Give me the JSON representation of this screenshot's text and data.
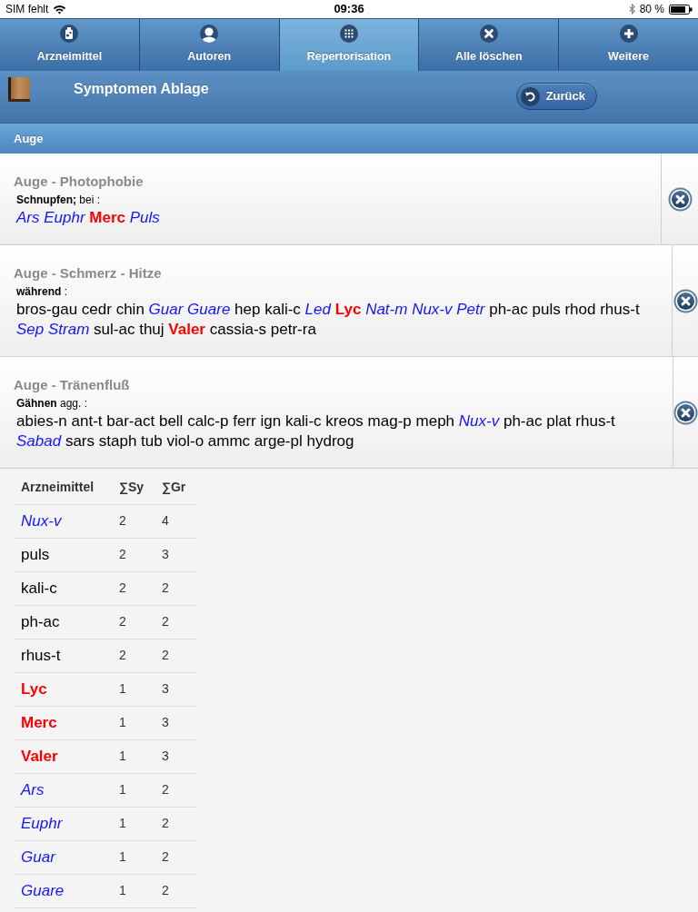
{
  "status_bar": {
    "carrier": "SIM fehlt",
    "time": "09:36",
    "battery": "80 %"
  },
  "tabs": [
    {
      "label": "Arzneimittel",
      "kind": "remedies",
      "selected": false
    },
    {
      "label": "Autoren",
      "kind": "authors",
      "selected": false
    },
    {
      "label": "Repertorisation",
      "kind": "repertory",
      "selected": true
    },
    {
      "label": "Alle löschen",
      "kind": "clear",
      "selected": false
    },
    {
      "label": "Weitere",
      "kind": "more",
      "selected": false
    }
  ],
  "header": {
    "title": "Symptomen Ablage",
    "back_button": "Zurück"
  },
  "section": {
    "title": "Auge"
  },
  "symptoms": [
    {
      "title": "Auge - Photophobie",
      "modifier": "**Schnupfen;** bei :",
      "remedies": [
        {
          "name": "Ars",
          "kind": "italic"
        },
        {
          "name": "Euphr",
          "kind": "italic"
        },
        {
          "name": "Merc",
          "kind": "bold"
        },
        {
          "name": "Puls",
          "kind": "italic"
        }
      ]
    },
    {
      "title": "Auge - Schmerz - Hitze",
      "modifier": "**während** :",
      "remedies": [
        {
          "name": "bros-gau",
          "kind": "plain"
        },
        {
          "name": "cedr",
          "kind": "plain"
        },
        {
          "name": "chin",
          "kind": "plain"
        },
        {
          "name": "Guar",
          "kind": "italic"
        },
        {
          "name": "Guare",
          "kind": "italic"
        },
        {
          "name": "hep",
          "kind": "plain"
        },
        {
          "name": "kali-c",
          "kind": "plain"
        },
        {
          "name": "Led",
          "kind": "italic"
        },
        {
          "name": "Lyc",
          "kind": "bold"
        },
        {
          "name": "Nat-m",
          "kind": "italic"
        },
        {
          "name": "Nux-v",
          "kind": "italic"
        },
        {
          "name": "Petr",
          "kind": "italic"
        },
        {
          "name": "ph-ac",
          "kind": "plain"
        },
        {
          "name": "puls",
          "kind": "plain"
        },
        {
          "name": "rhod",
          "kind": "plain"
        },
        {
          "name": "rhus-t",
          "kind": "plain"
        },
        {
          "name": "Sep",
          "kind": "italic"
        },
        {
          "name": "Stram",
          "kind": "italic"
        },
        {
          "name": "sul-ac",
          "kind": "plain"
        },
        {
          "name": "thuj",
          "kind": "plain"
        },
        {
          "name": "Valer",
          "kind": "bold"
        },
        {
          "name": "cassia-s",
          "kind": "plain"
        },
        {
          "name": "petr-ra",
          "kind": "plain"
        }
      ]
    },
    {
      "title": "Auge - Tränenfluß",
      "modifier": "**Gähnen** agg. :",
      "remedies": [
        {
          "name": "abies-n",
          "kind": "plain"
        },
        {
          "name": "ant-t",
          "kind": "plain"
        },
        {
          "name": "bar-act",
          "kind": "plain"
        },
        {
          "name": "bell",
          "kind": "plain"
        },
        {
          "name": "calc-p",
          "kind": "plain"
        },
        {
          "name": "ferr",
          "kind": "plain"
        },
        {
          "name": "ign",
          "kind": "plain"
        },
        {
          "name": "kali-c",
          "kind": "plain"
        },
        {
          "name": "kreos",
          "kind": "plain"
        },
        {
          "name": "mag-p",
          "kind": "plain"
        },
        {
          "name": "meph",
          "kind": "plain"
        },
        {
          "name": "Nux-v",
          "kind": "italic"
        },
        {
          "name": "ph-ac",
          "kind": "plain"
        },
        {
          "name": "plat",
          "kind": "plain"
        },
        {
          "name": "rhus-t",
          "kind": "plain"
        },
        {
          "name": "Sabad",
          "kind": "italic"
        },
        {
          "name": "sars",
          "kind": "plain"
        },
        {
          "name": "staph",
          "kind": "plain"
        },
        {
          "name": "tub",
          "kind": "plain"
        },
        {
          "name": "viol-o",
          "kind": "plain"
        },
        {
          "name": "ammc",
          "kind": "plain"
        },
        {
          "name": "arge-pl",
          "kind": "plain"
        },
        {
          "name": "hydrog",
          "kind": "plain"
        }
      ]
    }
  ],
  "table": {
    "columns": [
      "Arzneimittel",
      "∑Sy",
      "∑Gr"
    ],
    "rows": [
      {
        "remedy": "Nux-v",
        "kind": "italic",
        "sy": "2",
        "gr": "4"
      },
      {
        "remedy": "puls",
        "kind": "plain",
        "sy": "2",
        "gr": "3"
      },
      {
        "remedy": "kali-c",
        "kind": "plain",
        "sy": "2",
        "gr": "2"
      },
      {
        "remedy": "ph-ac",
        "kind": "plain",
        "sy": "2",
        "gr": "2"
      },
      {
        "remedy": "rhus-t",
        "kind": "plain",
        "sy": "2",
        "gr": "2"
      },
      {
        "remedy": "Lyc",
        "kind": "bold",
        "sy": "1",
        "gr": "3"
      },
      {
        "remedy": "Merc",
        "kind": "bold",
        "sy": "1",
        "gr": "3"
      },
      {
        "remedy": "Valer",
        "kind": "bold",
        "sy": "1",
        "gr": "3"
      },
      {
        "remedy": "Ars",
        "kind": "italic",
        "sy": "1",
        "gr": "2"
      },
      {
        "remedy": "Euphr",
        "kind": "italic",
        "sy": "1",
        "gr": "2"
      },
      {
        "remedy": "Guar",
        "kind": "italic",
        "sy": "1",
        "gr": "2"
      },
      {
        "remedy": "Guare",
        "kind": "italic",
        "sy": "1",
        "gr": "2"
      }
    ]
  }
}
